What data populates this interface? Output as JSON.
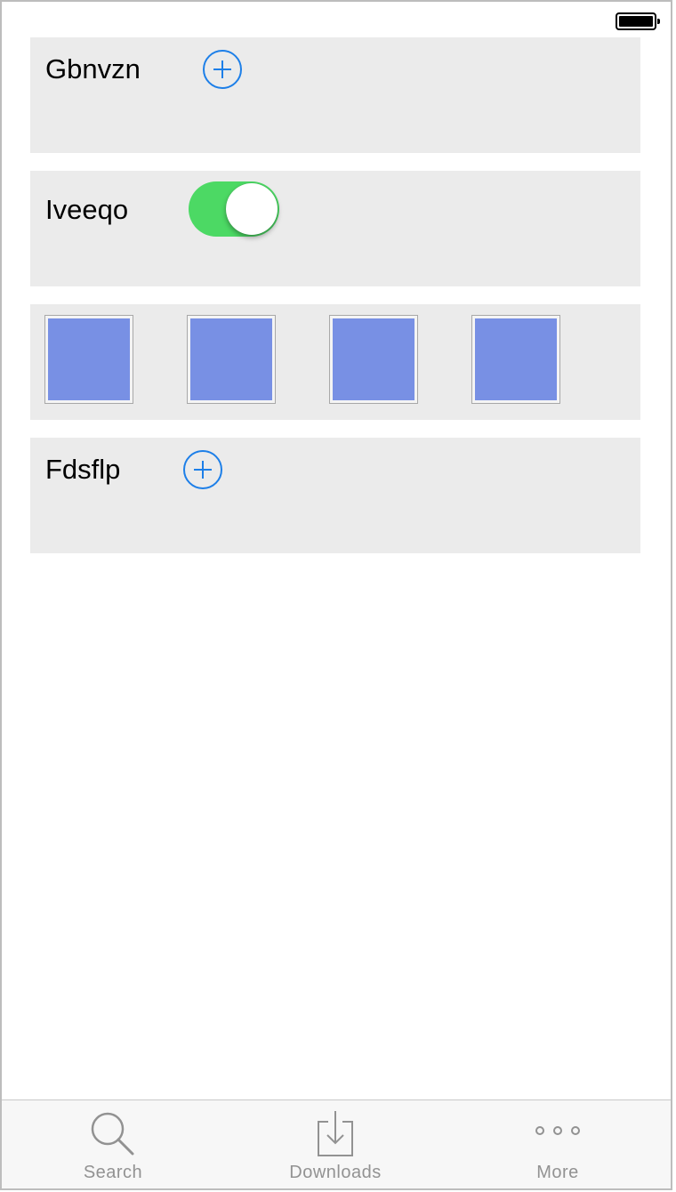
{
  "status_bar": {
    "battery_icon": "battery-full-icon"
  },
  "cards": [
    {
      "label": "Gbnvzn",
      "control": "add-button",
      "icon": "plus-circle-icon"
    },
    {
      "label": "Iveeqo",
      "control": "toggle",
      "toggle_on": true
    },
    {
      "swatches": [
        "#7890e4",
        "#7890e4",
        "#7890e4",
        "#7890e4"
      ]
    },
    {
      "label": "Fdsflp",
      "control": "add-button",
      "icon": "plus-circle-icon"
    }
  ],
  "tab_bar": {
    "tabs": [
      {
        "label": "Search",
        "icon": "search-icon"
      },
      {
        "label": "Downloads",
        "icon": "download-icon"
      },
      {
        "label": "More",
        "icon": "more-icon"
      }
    ]
  },
  "colors": {
    "accent": "#1d7fe8",
    "toggle_on": "#4cd964",
    "card_background": "#ebebeb",
    "swatch_color": "#7890e4",
    "tab_label": "#929292"
  }
}
